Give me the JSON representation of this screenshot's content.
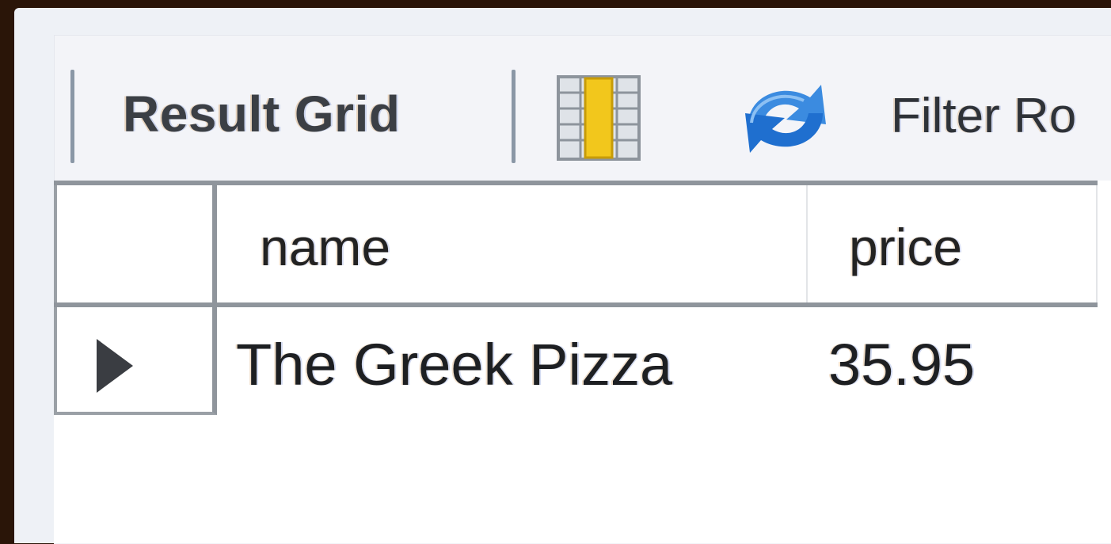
{
  "toolbar": {
    "result_grid_label": "Result Grid",
    "filter_label": "Filter Ro",
    "icons": [
      "grid-columns-icon",
      "refresh-icon"
    ],
    "colors": {
      "grid_icon_accent": "#f2c71c",
      "refresh_icon": "#3b8be0"
    }
  },
  "grid": {
    "columns": [
      "name",
      "price"
    ],
    "rows": [
      {
        "name": "The Greek Pizza",
        "price": "35.95"
      }
    ]
  }
}
